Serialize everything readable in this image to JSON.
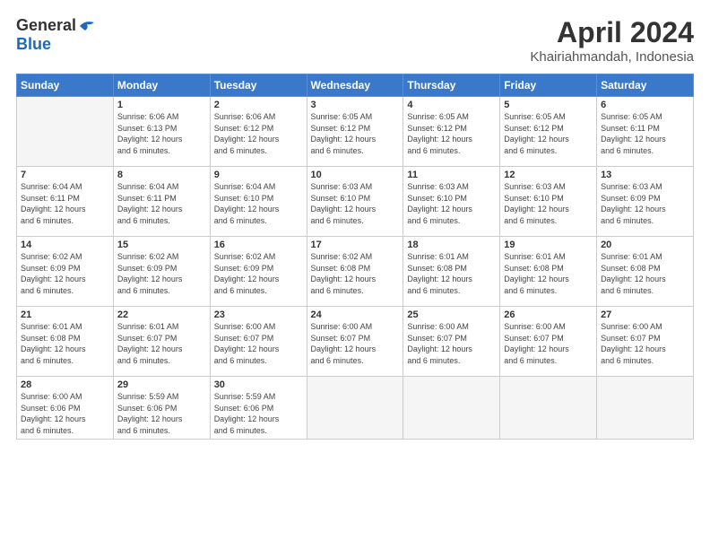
{
  "header": {
    "logo_general": "General",
    "logo_blue": "Blue",
    "month": "April 2024",
    "location": "Khairiahmandah, Indonesia"
  },
  "weekdays": [
    "Sunday",
    "Monday",
    "Tuesday",
    "Wednesday",
    "Thursday",
    "Friday",
    "Saturday"
  ],
  "weeks": [
    [
      {
        "day": "",
        "info": ""
      },
      {
        "day": "1",
        "info": "Sunrise: 6:06 AM\nSunset: 6:13 PM\nDaylight: 12 hours\nand 6 minutes."
      },
      {
        "day": "2",
        "info": "Sunrise: 6:06 AM\nSunset: 6:12 PM\nDaylight: 12 hours\nand 6 minutes."
      },
      {
        "day": "3",
        "info": "Sunrise: 6:05 AM\nSunset: 6:12 PM\nDaylight: 12 hours\nand 6 minutes."
      },
      {
        "day": "4",
        "info": "Sunrise: 6:05 AM\nSunset: 6:12 PM\nDaylight: 12 hours\nand 6 minutes."
      },
      {
        "day": "5",
        "info": "Sunrise: 6:05 AM\nSunset: 6:12 PM\nDaylight: 12 hours\nand 6 minutes."
      },
      {
        "day": "6",
        "info": "Sunrise: 6:05 AM\nSunset: 6:11 PM\nDaylight: 12 hours\nand 6 minutes."
      }
    ],
    [
      {
        "day": "7",
        "info": "Sunrise: 6:04 AM\nSunset: 6:11 PM\nDaylight: 12 hours\nand 6 minutes."
      },
      {
        "day": "8",
        "info": "Sunrise: 6:04 AM\nSunset: 6:11 PM\nDaylight: 12 hours\nand 6 minutes."
      },
      {
        "day": "9",
        "info": "Sunrise: 6:04 AM\nSunset: 6:10 PM\nDaylight: 12 hours\nand 6 minutes."
      },
      {
        "day": "10",
        "info": "Sunrise: 6:03 AM\nSunset: 6:10 PM\nDaylight: 12 hours\nand 6 minutes."
      },
      {
        "day": "11",
        "info": "Sunrise: 6:03 AM\nSunset: 6:10 PM\nDaylight: 12 hours\nand 6 minutes."
      },
      {
        "day": "12",
        "info": "Sunrise: 6:03 AM\nSunset: 6:10 PM\nDaylight: 12 hours\nand 6 minutes."
      },
      {
        "day": "13",
        "info": "Sunrise: 6:03 AM\nSunset: 6:09 PM\nDaylight: 12 hours\nand 6 minutes."
      }
    ],
    [
      {
        "day": "14",
        "info": "Sunrise: 6:02 AM\nSunset: 6:09 PM\nDaylight: 12 hours\nand 6 minutes."
      },
      {
        "day": "15",
        "info": "Sunrise: 6:02 AM\nSunset: 6:09 PM\nDaylight: 12 hours\nand 6 minutes."
      },
      {
        "day": "16",
        "info": "Sunrise: 6:02 AM\nSunset: 6:09 PM\nDaylight: 12 hours\nand 6 minutes."
      },
      {
        "day": "17",
        "info": "Sunrise: 6:02 AM\nSunset: 6:08 PM\nDaylight: 12 hours\nand 6 minutes."
      },
      {
        "day": "18",
        "info": "Sunrise: 6:01 AM\nSunset: 6:08 PM\nDaylight: 12 hours\nand 6 minutes."
      },
      {
        "day": "19",
        "info": "Sunrise: 6:01 AM\nSunset: 6:08 PM\nDaylight: 12 hours\nand 6 minutes."
      },
      {
        "day": "20",
        "info": "Sunrise: 6:01 AM\nSunset: 6:08 PM\nDaylight: 12 hours\nand 6 minutes."
      }
    ],
    [
      {
        "day": "21",
        "info": "Sunrise: 6:01 AM\nSunset: 6:08 PM\nDaylight: 12 hours\nand 6 minutes."
      },
      {
        "day": "22",
        "info": "Sunrise: 6:01 AM\nSunset: 6:07 PM\nDaylight: 12 hours\nand 6 minutes."
      },
      {
        "day": "23",
        "info": "Sunrise: 6:00 AM\nSunset: 6:07 PM\nDaylight: 12 hours\nand 6 minutes."
      },
      {
        "day": "24",
        "info": "Sunrise: 6:00 AM\nSunset: 6:07 PM\nDaylight: 12 hours\nand 6 minutes."
      },
      {
        "day": "25",
        "info": "Sunrise: 6:00 AM\nSunset: 6:07 PM\nDaylight: 12 hours\nand 6 minutes."
      },
      {
        "day": "26",
        "info": "Sunrise: 6:00 AM\nSunset: 6:07 PM\nDaylight: 12 hours\nand 6 minutes."
      },
      {
        "day": "27",
        "info": "Sunrise: 6:00 AM\nSunset: 6:07 PM\nDaylight: 12 hours\nand 6 minutes."
      }
    ],
    [
      {
        "day": "28",
        "info": "Sunrise: 6:00 AM\nSunset: 6:06 PM\nDaylight: 12 hours\nand 6 minutes."
      },
      {
        "day": "29",
        "info": "Sunrise: 5:59 AM\nSunset: 6:06 PM\nDaylight: 12 hours\nand 6 minutes."
      },
      {
        "day": "30",
        "info": "Sunrise: 5:59 AM\nSunset: 6:06 PM\nDaylight: 12 hours\nand 6 minutes."
      },
      {
        "day": "",
        "info": ""
      },
      {
        "day": "",
        "info": ""
      },
      {
        "day": "",
        "info": ""
      },
      {
        "day": "",
        "info": ""
      }
    ]
  ]
}
